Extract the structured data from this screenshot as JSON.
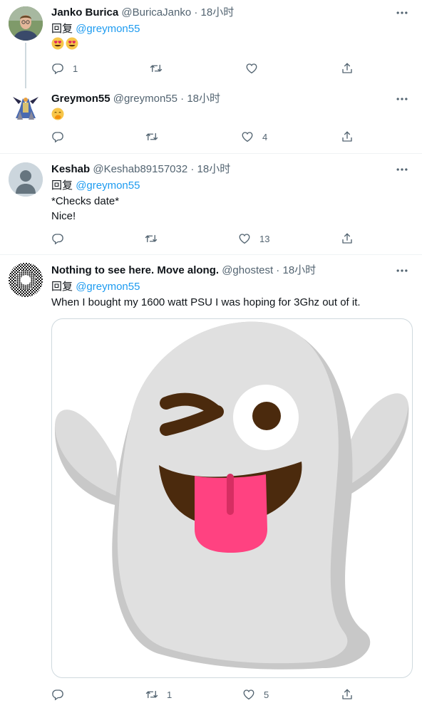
{
  "tweets": [
    {
      "name": "Janko Burica",
      "handle": "@BuricaJanko",
      "sep": " · ",
      "time": "18小时",
      "reply_label": "回复",
      "reply_to": "@greymon55",
      "content_emojis": [
        "smiling-face-with-heart-eyes",
        "smiling-face-with-heart-eyes"
      ],
      "reply_count": "1",
      "retweet_count": "",
      "like_count": ""
    },
    {
      "name": "Greymon55",
      "handle": "@greymon55",
      "sep": " · ",
      "time": "18小时",
      "content_emojis": [
        "face-with-hand-over-mouth"
      ],
      "reply_count": "",
      "retweet_count": "",
      "like_count": "4"
    },
    {
      "name": "Keshab",
      "handle": "@Keshab89157032",
      "sep": " · ",
      "time": "18小时",
      "reply_label": "回复",
      "reply_to": "@greymon55",
      "text_line1": "*Checks date*",
      "text_line2": "Nice!",
      "reply_count": "",
      "retweet_count": "",
      "like_count": "13"
    },
    {
      "name": "Nothing to see here. Move along.",
      "handle": "@ghostest",
      "sep": " · ",
      "time": "18小时",
      "reply_label": "回复",
      "reply_to": "@greymon55",
      "text": "When I bought my 1600 watt PSU I was hoping for 3Ghz out of it.",
      "media_emoji": "ghost",
      "reply_count": "",
      "retweet_count": "1",
      "like_count": "5"
    }
  ],
  "colors": {
    "link": "#1d9bf0",
    "secondary": "#536471",
    "divider": "#eff3f4"
  }
}
